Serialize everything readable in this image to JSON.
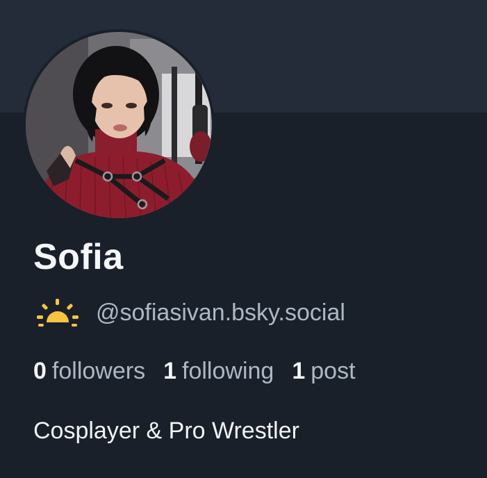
{
  "profile": {
    "display_name": "Sofia",
    "status_emoji": "sun-icon",
    "handle": "@sofiasivan.bsky.social",
    "bio": "Cosplayer & Pro Wrestler"
  },
  "stats": {
    "followers_count": "0",
    "followers_label": "followers",
    "following_count": "1",
    "following_label": "following",
    "posts_count": "1",
    "posts_label": "post"
  },
  "colors": {
    "background": "#19202a",
    "banner": "#232c38",
    "muted_text": "#aeb8c4",
    "sun": "#f5c542"
  }
}
